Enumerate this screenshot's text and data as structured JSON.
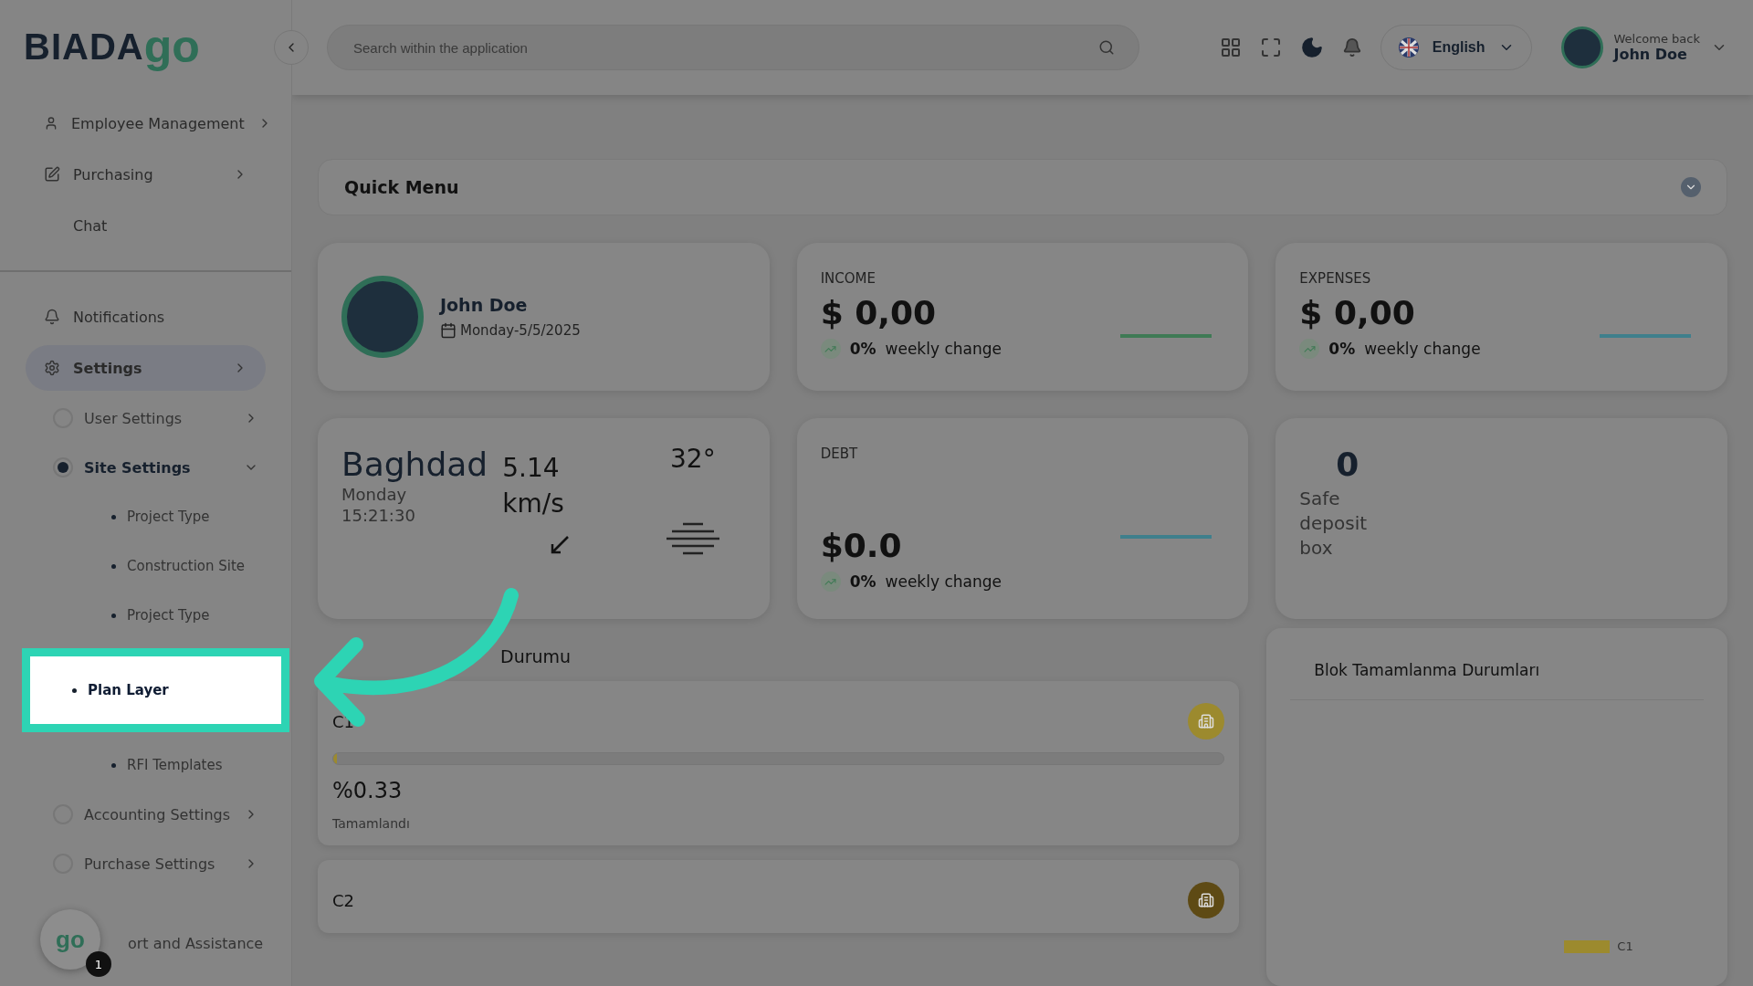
{
  "sidebar": {
    "logo": {
      "dark": "BIADA",
      "accent": "go"
    },
    "items": [
      {
        "label": "Employee Management",
        "has_children": true
      },
      {
        "label": "Purchasing",
        "has_children": true
      },
      {
        "label": "Chat",
        "has_children": false
      }
    ],
    "lower_items": [
      {
        "label": "Notifications",
        "has_children": false,
        "selected": false
      },
      {
        "label": "Settings",
        "has_children": true,
        "selected": true,
        "children": [
          {
            "label": "User Settings",
            "selected": false,
            "expanded": false
          },
          {
            "label": "Site Settings",
            "selected": true,
            "expanded": true,
            "children": [
              {
                "label": "Project Type",
                "highlighted": false
              },
              {
                "label": "Construction Site",
                "highlighted": false
              },
              {
                "label": "Project Type",
                "highlighted": false
              },
              {
                "label": "Plan Layer",
                "highlighted": true
              },
              {
                "label": "RFI Templates",
                "highlighted": false
              }
            ]
          },
          {
            "label": "Accounting Settings",
            "selected": false,
            "expanded": false
          },
          {
            "label": "Purchase Settings",
            "selected": false,
            "expanded": false
          }
        ]
      }
    ],
    "footer_item": {
      "label": "ort and Assistance"
    },
    "chat_logo": "go",
    "chat_badge": "1"
  },
  "header": {
    "search": {
      "placeholder": "Search within the application"
    },
    "language": "English",
    "welcome": "Welcome back",
    "user": "John Doe"
  },
  "quick_menu": {
    "title": "Quick Menu",
    "expanded": false
  },
  "profile": {
    "name": "John Doe",
    "date": "Monday-5/5/2025"
  },
  "stats": [
    {
      "label": "INCOME",
      "amount": "$ 0,00",
      "change": "0%",
      "change_label": "weekly change",
      "color": "#3f7a55"
    },
    {
      "label": "EXPENSES",
      "amount": "$ 0,00",
      "change": "0%",
      "change_label": "weekly change",
      "color": "#3f7f8c"
    }
  ],
  "weather": {
    "city": "Baghdad",
    "day": "Monday",
    "time": "15:21:30",
    "wind": "5.14",
    "wind_unit": "km/s",
    "temp": "32°"
  },
  "debt": {
    "label": "DEBT",
    "amount": "$0.0",
    "change": "0%",
    "change_label": "weekly change",
    "color": "#3f7f8c"
  },
  "safe": {
    "count": "0",
    "label": "Safe deposit box"
  },
  "blocks_title": "Durumu",
  "blocks": [
    {
      "name": "C1",
      "level": 0.0033,
      "percent": "%0.33",
      "status": "Tamamlandı",
      "color": "#9c8a2e"
    },
    {
      "name": "C2",
      "color": "#5e4a14"
    }
  ],
  "completion": {
    "title": "Blok Tamamlanma Durumları",
    "legend": [
      {
        "label": "C1",
        "color": "#9c8a2e"
      }
    ]
  }
}
